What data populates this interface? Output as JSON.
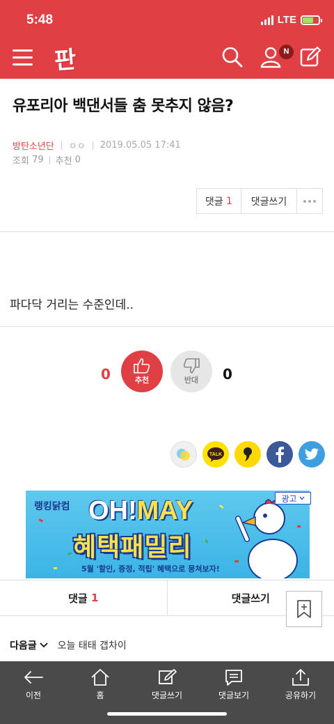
{
  "status": {
    "time": "5:48",
    "network": "LTE"
  },
  "header": {
    "logo": "판",
    "notification_badge": "N"
  },
  "post": {
    "title": "유포리아 백댄서들 춤 못추지 않음?",
    "author": "방탄소년단",
    "author_extra": "ㅇㅇ",
    "datetime": "2019.05.05 17:41",
    "views_label": "조회",
    "views": "79",
    "recommend_label": "추천",
    "recommend": "0",
    "body": "파다닥 거리는 수준인데.."
  },
  "actions": {
    "comment_label": "댓글",
    "comment_count": "1",
    "write_comment": "댓글쓰기"
  },
  "votes": {
    "up_count": "0",
    "up_label": "추천",
    "down_label": "반대",
    "down_count": "0"
  },
  "share": [
    "kakaostory-icon",
    "kakaotalk-icon",
    "kakaopage-icon",
    "facebook-icon",
    "twitter-icon"
  ],
  "share_talk_text": "TALK",
  "ad": {
    "tag": "광고",
    "brand": "랭킹닭컴",
    "headline_a": "OH!",
    "headline_b": "MAY",
    "main": "혜택패밀리",
    "sub": "5월 '할인, 증정, 적립' 혜택으로 뭉쳐보자!"
  },
  "comment_bar": {
    "comments": "댓글",
    "count": "1",
    "write": "댓글쓰기"
  },
  "next": {
    "label": "다음글",
    "title": "오늘 태태 갭차이"
  },
  "bottom_nav": [
    {
      "label": "이전",
      "icon": "back-arrow-icon"
    },
    {
      "label": "홈",
      "icon": "home-icon"
    },
    {
      "label": "댓글쓰기",
      "icon": "write-comment-icon"
    },
    {
      "label": "댓글보기",
      "icon": "view-comments-icon"
    },
    {
      "label": "공유하기",
      "icon": "share-icon"
    }
  ],
  "colors": {
    "brand": "#e04044",
    "nav_bg": "#4a4a4a",
    "ad_bg": "#3bb4e6"
  }
}
